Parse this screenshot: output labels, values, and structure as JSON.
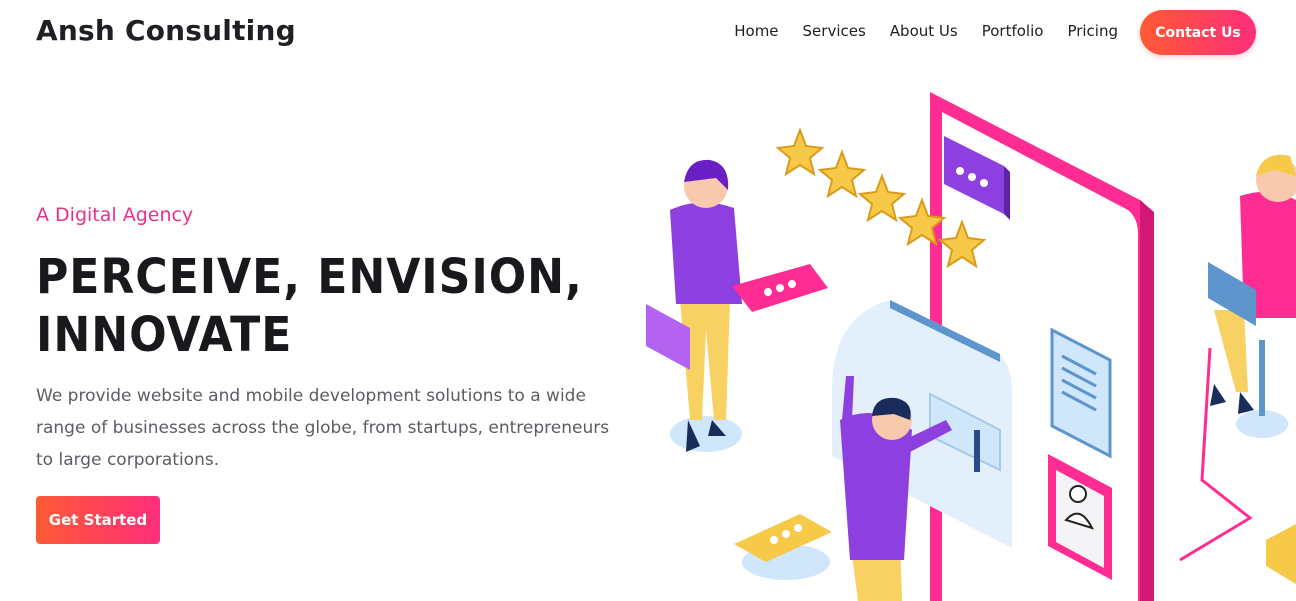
{
  "header": {
    "brand": "Ansh Consulting",
    "nav": [
      {
        "label": "Home"
      },
      {
        "label": "Services"
      },
      {
        "label": "About Us"
      },
      {
        "label": "Portfolio"
      },
      {
        "label": "Pricing"
      }
    ],
    "contact_label": "Contact Us"
  },
  "hero": {
    "eyebrow": "A Digital Agency",
    "headline_line1": "PERCEIVE, ENVISION,",
    "headline_line2": "INNOVATE",
    "description": "We provide website and mobile development solutions to a wide range of businesses across the globe, from startups, entrepreneurs to large corporations.",
    "cta_label": "Get Started"
  },
  "colors": {
    "accent_pink": "#e8318b",
    "gradient_start": "#ff5a34",
    "gradient_end": "#ff2e7a",
    "purple": "#8e44e8",
    "yellow": "#f7c948",
    "light_blue": "#d6eafc"
  },
  "icons": {
    "illustration": "isometric-mobile-app-team-illustration"
  }
}
